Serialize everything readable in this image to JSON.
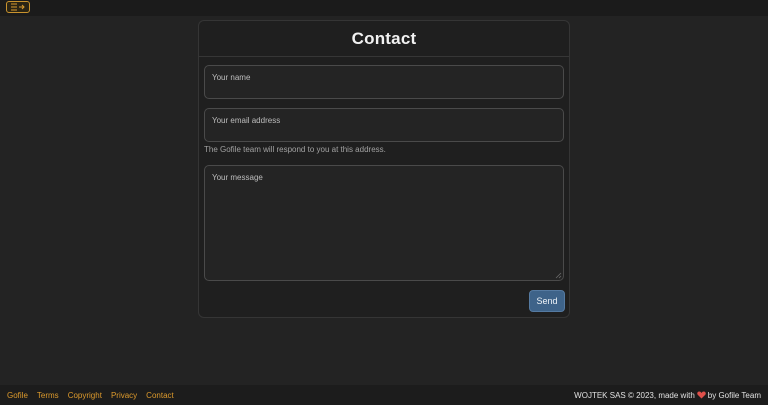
{
  "header": {
    "menu_icon": "menu-expand-icon"
  },
  "contact": {
    "title": "Contact",
    "name_placeholder": "Your name",
    "email_placeholder": "Your email address",
    "email_helper": "The Gofile team will respond to you at this address.",
    "message_placeholder": "Your message",
    "send_label": "Send"
  },
  "footer": {
    "links": [
      "Gofile",
      "Terms",
      "Copyright",
      "Privacy",
      "Contact"
    ],
    "credit_prefix": "WOJTEK SAS © 2023, made with",
    "credit_suffix": "by Gofile Team",
    "heart_icon": "heart-icon"
  },
  "colors": {
    "accent": "#dd9a2c",
    "button": "#3e6389",
    "heart": "#e0504a",
    "background": "#232323"
  }
}
